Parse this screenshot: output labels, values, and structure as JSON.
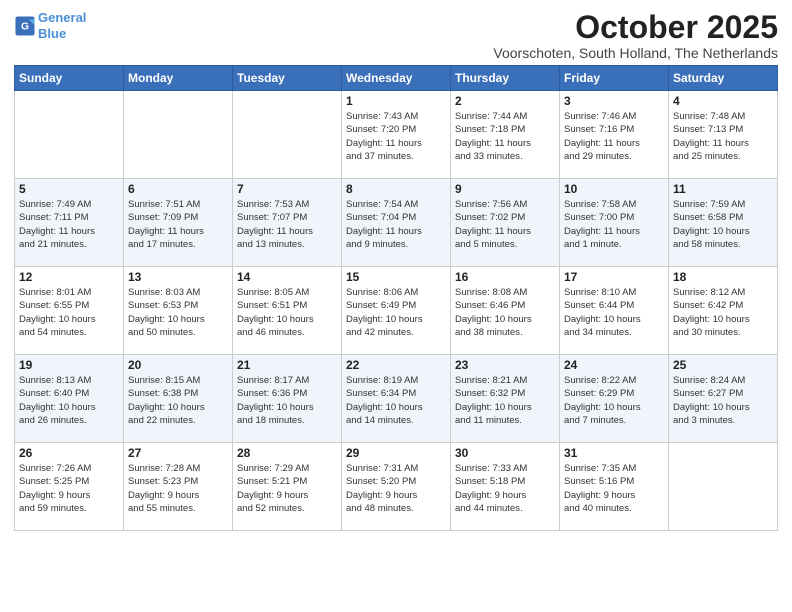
{
  "header": {
    "logo_line1": "General",
    "logo_line2": "Blue",
    "month": "October 2025",
    "location": "Voorschoten, South Holland, The Netherlands"
  },
  "days_of_week": [
    "Sunday",
    "Monday",
    "Tuesday",
    "Wednesday",
    "Thursday",
    "Friday",
    "Saturday"
  ],
  "weeks": [
    [
      {
        "num": "",
        "info": ""
      },
      {
        "num": "",
        "info": ""
      },
      {
        "num": "",
        "info": ""
      },
      {
        "num": "1",
        "info": "Sunrise: 7:43 AM\nSunset: 7:20 PM\nDaylight: 11 hours\nand 37 minutes."
      },
      {
        "num": "2",
        "info": "Sunrise: 7:44 AM\nSunset: 7:18 PM\nDaylight: 11 hours\nand 33 minutes."
      },
      {
        "num": "3",
        "info": "Sunrise: 7:46 AM\nSunset: 7:16 PM\nDaylight: 11 hours\nand 29 minutes."
      },
      {
        "num": "4",
        "info": "Sunrise: 7:48 AM\nSunset: 7:13 PM\nDaylight: 11 hours\nand 25 minutes."
      }
    ],
    [
      {
        "num": "5",
        "info": "Sunrise: 7:49 AM\nSunset: 7:11 PM\nDaylight: 11 hours\nand 21 minutes."
      },
      {
        "num": "6",
        "info": "Sunrise: 7:51 AM\nSunset: 7:09 PM\nDaylight: 11 hours\nand 17 minutes."
      },
      {
        "num": "7",
        "info": "Sunrise: 7:53 AM\nSunset: 7:07 PM\nDaylight: 11 hours\nand 13 minutes."
      },
      {
        "num": "8",
        "info": "Sunrise: 7:54 AM\nSunset: 7:04 PM\nDaylight: 11 hours\nand 9 minutes."
      },
      {
        "num": "9",
        "info": "Sunrise: 7:56 AM\nSunset: 7:02 PM\nDaylight: 11 hours\nand 5 minutes."
      },
      {
        "num": "10",
        "info": "Sunrise: 7:58 AM\nSunset: 7:00 PM\nDaylight: 11 hours\nand 1 minute."
      },
      {
        "num": "11",
        "info": "Sunrise: 7:59 AM\nSunset: 6:58 PM\nDaylight: 10 hours\nand 58 minutes."
      }
    ],
    [
      {
        "num": "12",
        "info": "Sunrise: 8:01 AM\nSunset: 6:55 PM\nDaylight: 10 hours\nand 54 minutes."
      },
      {
        "num": "13",
        "info": "Sunrise: 8:03 AM\nSunset: 6:53 PM\nDaylight: 10 hours\nand 50 minutes."
      },
      {
        "num": "14",
        "info": "Sunrise: 8:05 AM\nSunset: 6:51 PM\nDaylight: 10 hours\nand 46 minutes."
      },
      {
        "num": "15",
        "info": "Sunrise: 8:06 AM\nSunset: 6:49 PM\nDaylight: 10 hours\nand 42 minutes."
      },
      {
        "num": "16",
        "info": "Sunrise: 8:08 AM\nSunset: 6:46 PM\nDaylight: 10 hours\nand 38 minutes."
      },
      {
        "num": "17",
        "info": "Sunrise: 8:10 AM\nSunset: 6:44 PM\nDaylight: 10 hours\nand 34 minutes."
      },
      {
        "num": "18",
        "info": "Sunrise: 8:12 AM\nSunset: 6:42 PM\nDaylight: 10 hours\nand 30 minutes."
      }
    ],
    [
      {
        "num": "19",
        "info": "Sunrise: 8:13 AM\nSunset: 6:40 PM\nDaylight: 10 hours\nand 26 minutes."
      },
      {
        "num": "20",
        "info": "Sunrise: 8:15 AM\nSunset: 6:38 PM\nDaylight: 10 hours\nand 22 minutes."
      },
      {
        "num": "21",
        "info": "Sunrise: 8:17 AM\nSunset: 6:36 PM\nDaylight: 10 hours\nand 18 minutes."
      },
      {
        "num": "22",
        "info": "Sunrise: 8:19 AM\nSunset: 6:34 PM\nDaylight: 10 hours\nand 14 minutes."
      },
      {
        "num": "23",
        "info": "Sunrise: 8:21 AM\nSunset: 6:32 PM\nDaylight: 10 hours\nand 11 minutes."
      },
      {
        "num": "24",
        "info": "Sunrise: 8:22 AM\nSunset: 6:29 PM\nDaylight: 10 hours\nand 7 minutes."
      },
      {
        "num": "25",
        "info": "Sunrise: 8:24 AM\nSunset: 6:27 PM\nDaylight: 10 hours\nand 3 minutes."
      }
    ],
    [
      {
        "num": "26",
        "info": "Sunrise: 7:26 AM\nSunset: 5:25 PM\nDaylight: 9 hours\nand 59 minutes."
      },
      {
        "num": "27",
        "info": "Sunrise: 7:28 AM\nSunset: 5:23 PM\nDaylight: 9 hours\nand 55 minutes."
      },
      {
        "num": "28",
        "info": "Sunrise: 7:29 AM\nSunset: 5:21 PM\nDaylight: 9 hours\nand 52 minutes."
      },
      {
        "num": "29",
        "info": "Sunrise: 7:31 AM\nSunset: 5:20 PM\nDaylight: 9 hours\nand 48 minutes."
      },
      {
        "num": "30",
        "info": "Sunrise: 7:33 AM\nSunset: 5:18 PM\nDaylight: 9 hours\nand 44 minutes."
      },
      {
        "num": "31",
        "info": "Sunrise: 7:35 AM\nSunset: 5:16 PM\nDaylight: 9 hours\nand 40 minutes."
      },
      {
        "num": "",
        "info": ""
      }
    ]
  ]
}
